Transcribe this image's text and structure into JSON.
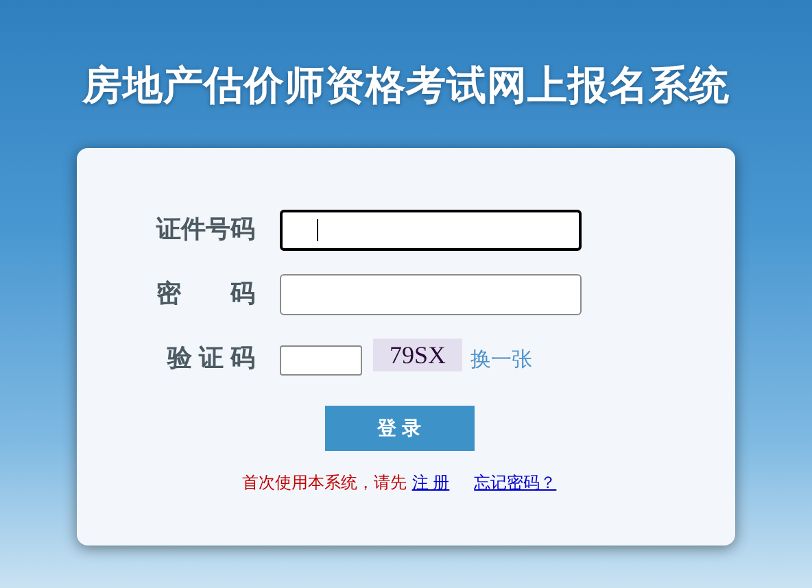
{
  "title": "房地产估价师资格考试网上报名系统",
  "fields": [
    {
      "label": "证件号码",
      "kind": "text",
      "focused": true
    },
    {
      "label": "密　　码",
      "kind": "password",
      "focused": false
    },
    {
      "label": "验 证 码",
      "kind": "captcha",
      "focused": false,
      "captcha": "79SX",
      "refresh": "换一张"
    }
  ],
  "login_button": "登 录",
  "note": "首次使用本系统，请先",
  "links": [
    "注 册",
    "忘记密码？"
  ]
}
